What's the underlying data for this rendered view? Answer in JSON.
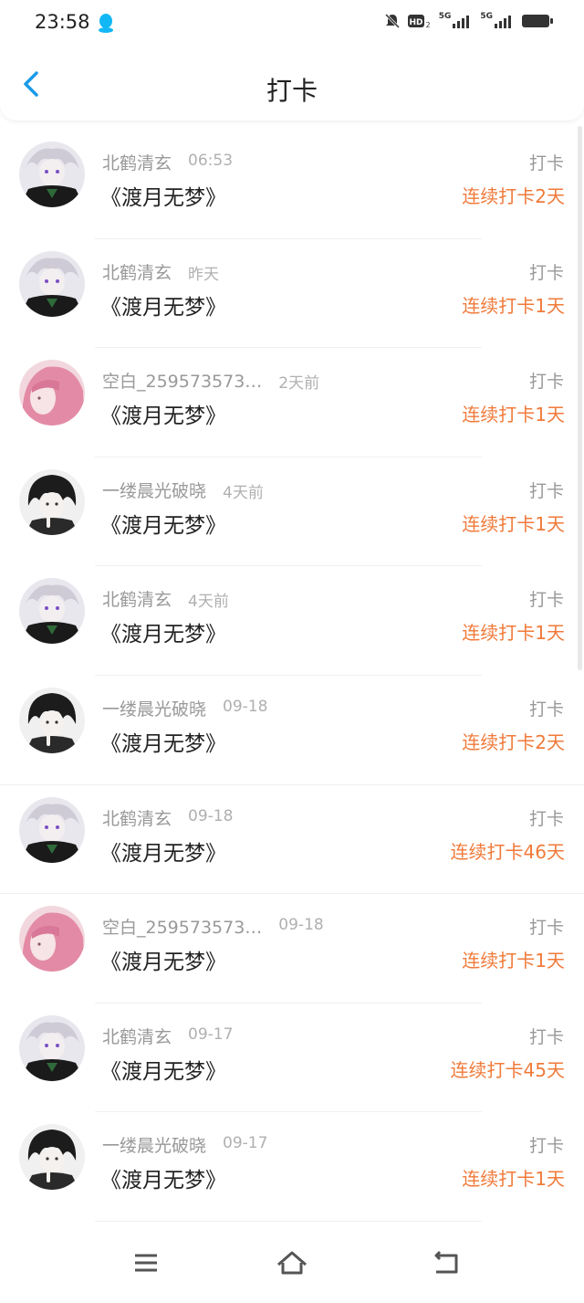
{
  "status_bar": {
    "time": "23:58",
    "signal_label_1": "5G",
    "signal_label_2": "5G"
  },
  "header": {
    "title": "打卡"
  },
  "entries": [
    {
      "user": "北鹤清玄",
      "time": "06:53",
      "title": "《渡月无梦》",
      "action": "打卡",
      "streak": "连续打卡2天",
      "avatar": "white-hair"
    },
    {
      "user": "北鹤清玄",
      "time": "昨天",
      "title": "《渡月无梦》",
      "action": "打卡",
      "streak": "连续打卡1天",
      "avatar": "white-hair"
    },
    {
      "user": "空白_259573573…",
      "time": "2天前",
      "title": "《渡月无梦》",
      "action": "打卡",
      "streak": "连续打卡1天",
      "avatar": "pink-hair"
    },
    {
      "user": "一缕晨光破晓",
      "time": "4天前",
      "title": "《渡月无梦》",
      "action": "打卡",
      "streak": "连续打卡1天",
      "avatar": "dark-hair"
    },
    {
      "user": "北鹤清玄",
      "time": "4天前",
      "title": "《渡月无梦》",
      "action": "打卡",
      "streak": "连续打卡1天",
      "avatar": "white-hair"
    },
    {
      "user": "一缕晨光破晓",
      "time": "09-18",
      "title": "《渡月无梦》",
      "action": "打卡",
      "streak": "连续打卡2天",
      "avatar": "dark-hair"
    },
    {
      "user": "北鹤清玄",
      "time": "09-18",
      "title": "《渡月无梦》",
      "action": "打卡",
      "streak": "连续打卡46天",
      "avatar": "white-hair"
    },
    {
      "user": "空白_259573573…",
      "time": "09-18",
      "title": "《渡月无梦》",
      "action": "打卡",
      "streak": "连续打卡1天",
      "avatar": "pink-hair"
    },
    {
      "user": "北鹤清玄",
      "time": "09-17",
      "title": "《渡月无梦》",
      "action": "打卡",
      "streak": "连续打卡45天",
      "avatar": "white-hair"
    },
    {
      "user": "一缕晨光破晓",
      "time": "09-17",
      "title": "《渡月无梦》",
      "action": "打卡",
      "streak": "连续打卡1天",
      "avatar": "dark-hair"
    }
  ],
  "colors": {
    "accent": "#1a9be8",
    "streak": "#f07a3a",
    "muted": "#999999"
  }
}
